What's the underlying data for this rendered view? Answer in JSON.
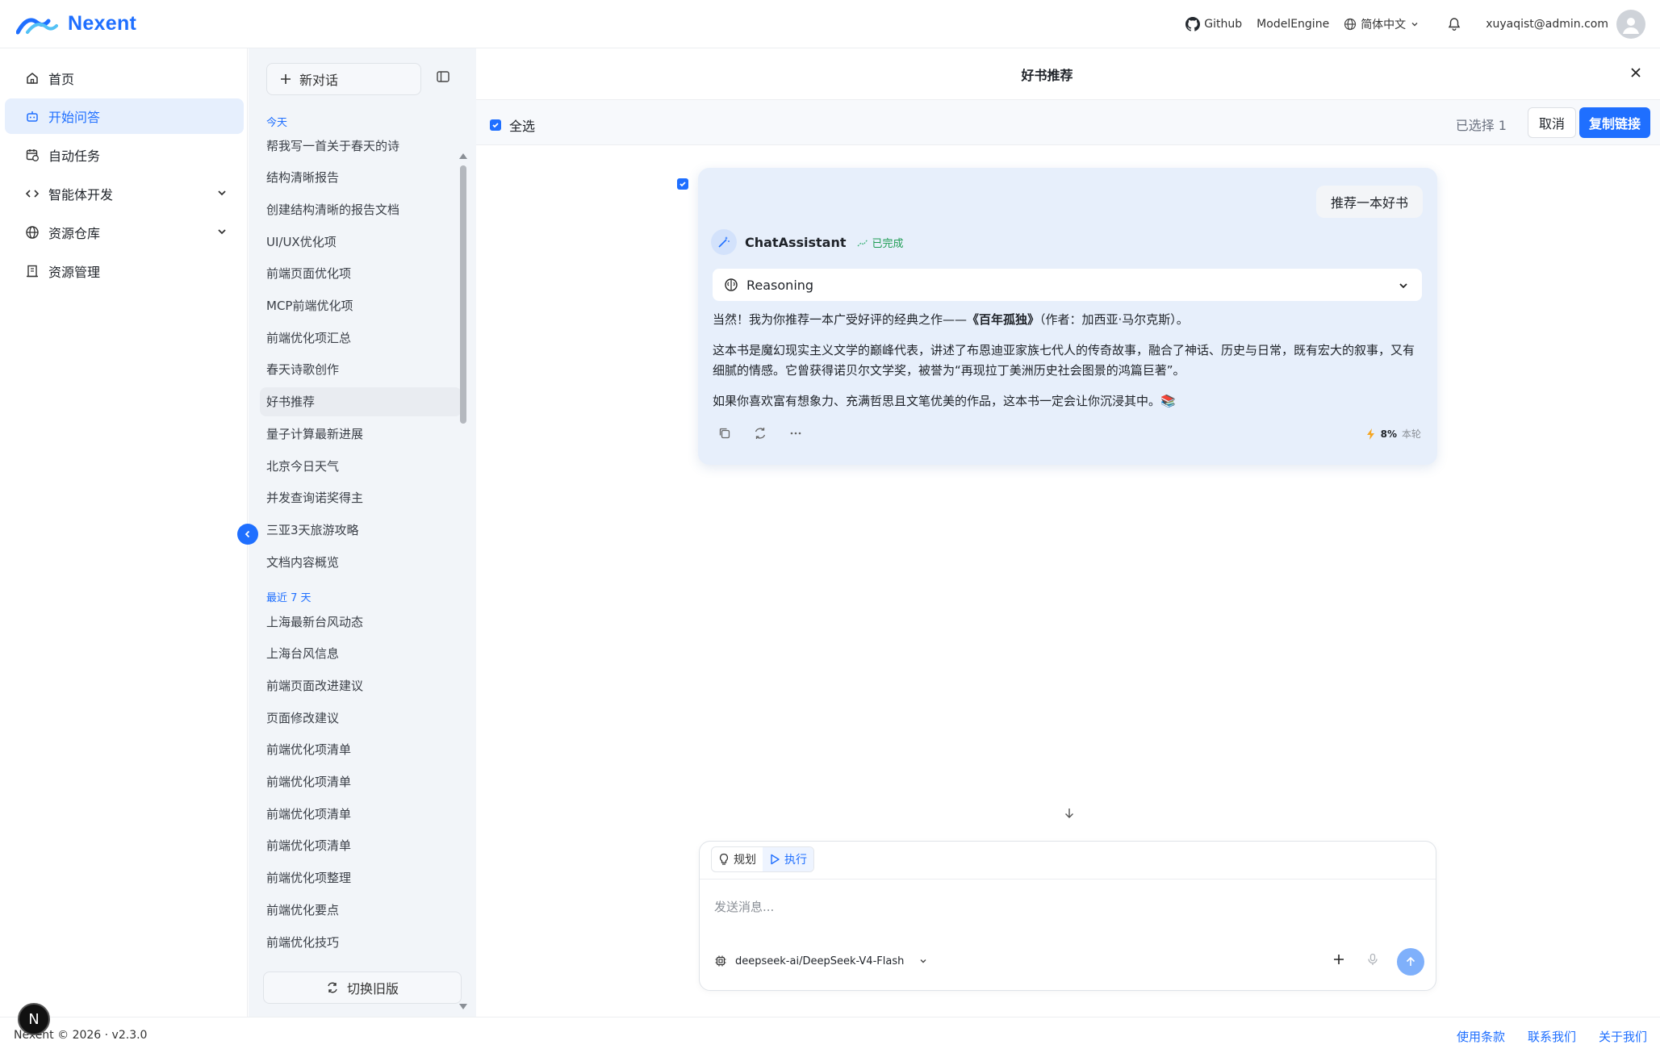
{
  "header": {
    "logo_text": "Nexent",
    "github_label": "Github",
    "modelengine_label": "ModelEngine",
    "language_label": "简体中文",
    "user_email": "xuyaqist@admin.com"
  },
  "sidebar": {
    "items": [
      {
        "label": "首页",
        "icon": "home-icon"
      },
      {
        "label": "开始问答",
        "icon": "bot-icon",
        "active": true
      },
      {
        "label": "自动任务",
        "icon": "calendar-clock-icon"
      },
      {
        "label": "智能体开发",
        "icon": "code-icon",
        "expandable": true
      },
      {
        "label": "资源仓库",
        "icon": "globe-icon",
        "expandable": true
      },
      {
        "label": "资源管理",
        "icon": "building-icon"
      }
    ]
  },
  "history": {
    "new_chat_label": "新对话",
    "today_label": "今天",
    "today_items": [
      "帮我写一首关于春天的诗",
      "结构清晰报告",
      "创建结构清晰的报告文档",
      "UI/UX优化项",
      "前端页面优化项",
      "MCP前端优化项",
      "前端优化项汇总",
      "春天诗歌创作",
      "好书推荐",
      "量子计算最新进展",
      "北京今日天气",
      "并发查询诺奖得主",
      "三亚3天旅游攻略",
      "文档内容概览"
    ],
    "selected_item": "好书推荐",
    "week_label": "最近 7 天",
    "week_items": [
      "上海最新台风动态",
      "上海台风信息",
      "前端页面改进建议",
      "页面修改建议",
      "前端优化项清单",
      "前端优化项清单",
      "前端优化项清单",
      "前端优化项清单",
      "前端优化项整理",
      "前端优化要点",
      "前端优化技巧"
    ],
    "switch_old_label": "切换旧版"
  },
  "main": {
    "title": "好书推荐",
    "select_all_label": "全选",
    "selected_count_text": "已选择 1",
    "cancel_label": "取消",
    "copy_link_label": "复制链接",
    "user_message": "推荐一本好书",
    "assistant_name": "ChatAssistant",
    "status_label": "已完成",
    "reasoning_label": "Reasoning",
    "answer_p1_before": "当然！我为你推荐一本广受好评的经典之作——",
    "answer_p1_bold": "《百年孤独》",
    "answer_p1_after": "（作者：加西亚·马尔克斯）。",
    "answer_p2": "这本书是魔幻现实主义文学的巅峰代表，讲述了布恩迪亚家族七代人的传奇故事，融合了神话、历史与日常，既有宏大的叙事，又有细腻的情感。它曾获得诺贝尔文学奖，被誉为“再现拉丁美洲历史社会图景的鸿篇巨著”。",
    "answer_p3": "如果你喜欢富有想象力、充满哲思且文笔优美的作品，这本书一定会让你沉浸其中。📚",
    "token_percent": "8%",
    "token_label": "本轮"
  },
  "input": {
    "mode_plan": "规划",
    "mode_execute": "执行",
    "placeholder": "发送消息...",
    "model_name": "deepseek-ai/DeepSeek-V4-Flash"
  },
  "footer": {
    "copyright": "Nexent © 2026 · v2.3.0",
    "links": [
      "使用条款",
      "联系我们",
      "关于我们"
    ]
  },
  "badge_letter": "N",
  "colors": {
    "accent": "#1f6fff",
    "active_bg": "#e6effd",
    "card_bg": "#e7effb",
    "success": "#1f9d55"
  }
}
